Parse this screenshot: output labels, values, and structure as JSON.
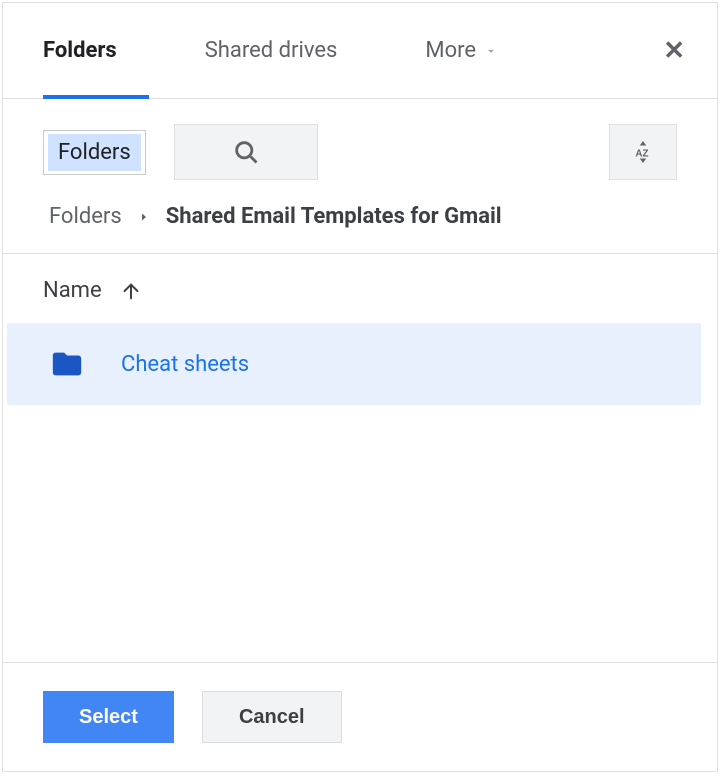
{
  "tabs": {
    "folders": "Folders",
    "shared_drives": "Shared drives",
    "more": "More"
  },
  "toolbar": {
    "folders_label": "Folders"
  },
  "breadcrumb": {
    "root": "Folders",
    "current": "Shared Email Templates for Gmail"
  },
  "list": {
    "header_name": "Name"
  },
  "items": [
    {
      "name": "Cheat sheets"
    }
  ],
  "footer": {
    "select": "Select",
    "cancel": "Cancel"
  }
}
